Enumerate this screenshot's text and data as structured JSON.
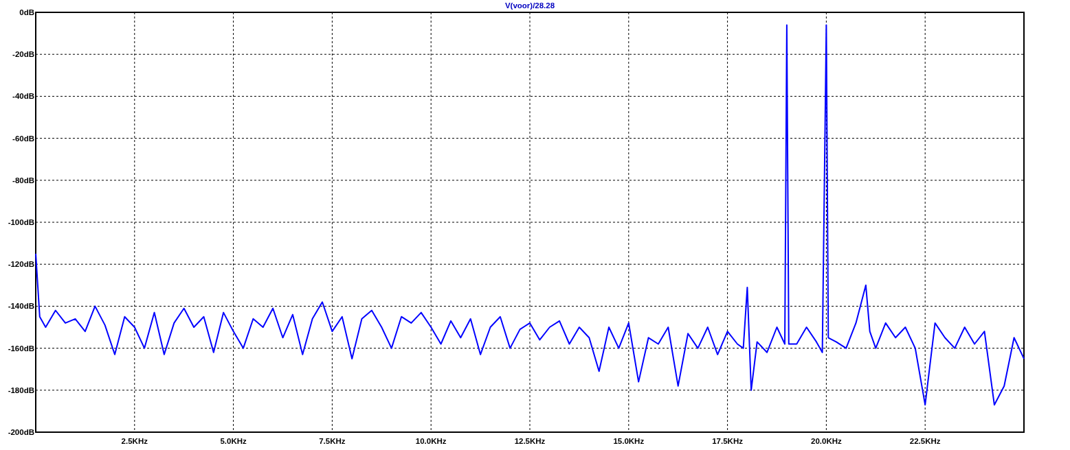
{
  "plot": {
    "chart_data": {
      "type": "line",
      "title": "V(voor)/28.28",
      "x": [
        0,
        0.1,
        0.25,
        0.5,
        0.75,
        1,
        1.25,
        1.5,
        1.75,
        2,
        2.25,
        2.5,
        2.75,
        3,
        3.25,
        3.5,
        3.75,
        4,
        4.25,
        4.5,
        4.75,
        5,
        5.25,
        5.5,
        5.75,
        6,
        6.25,
        6.5,
        6.75,
        7,
        7.25,
        7.5,
        7.75,
        8,
        8.25,
        8.5,
        8.75,
        9,
        9.25,
        9.5,
        9.75,
        10,
        10.25,
        10.5,
        10.75,
        11,
        11.25,
        11.5,
        11.75,
        12,
        12.25,
        12.5,
        12.75,
        13,
        13.25,
        13.5,
        13.75,
        14,
        14.25,
        14.5,
        14.75,
        15,
        15.25,
        15.5,
        15.75,
        16,
        16.25,
        16.5,
        16.75,
        17,
        17.25,
        17.5,
        17.75,
        17.9,
        18,
        18.1,
        18.25,
        18.5,
        18.75,
        18.95,
        19,
        19.05,
        19.25,
        19.5,
        19.75,
        19.9,
        20,
        20.05,
        20.25,
        20.5,
        20.75,
        21,
        21.1,
        21.25,
        21.5,
        21.75,
        22,
        22.25,
        22.5,
        22.75,
        23,
        23.25,
        23.5,
        23.75,
        24,
        24.25,
        24.5,
        24.75,
        25
      ],
      "series": [
        {
          "color": "#0000ff",
          "values": [
            -115,
            -145,
            -150,
            -142,
            -148,
            -146,
            -152,
            -140,
            -149,
            -163,
            -145,
            -150,
            -160,
            -143,
            -163,
            -148,
            -141,
            -150,
            -145,
            -162,
            -143,
            -152,
            -160,
            -146,
            -150,
            -141,
            -155,
            -144,
            -163,
            -146,
            -138,
            -152,
            -145,
            -165,
            -146,
            -142,
            -150,
            -160,
            -145,
            -148,
            -143,
            -150,
            -158,
            -147,
            -155,
            -146,
            -163,
            -150,
            -145,
            -160,
            -151,
            -148,
            -156,
            -150,
            -147,
            -158,
            -150,
            -155,
            -171,
            -150,
            -160,
            -148,
            -176,
            -155,
            -158,
            -150,
            -178,
            -153,
            -160,
            -150,
            -163,
            -152,
            -158,
            -160,
            -131,
            -180,
            -157,
            -162,
            -150,
            -158,
            -6,
            -158,
            -158,
            -150,
            -157,
            -162,
            -6,
            -155,
            -157,
            -160,
            -148,
            -130,
            -152,
            -160,
            -148,
            -155,
            -150,
            -160,
            -187,
            -148,
            -155,
            -160,
            -150,
            -158,
            -152,
            -187,
            -178,
            -155,
            -165
          ]
        }
      ],
      "grid": true,
      "xlim": [
        0,
        25
      ],
      "ylim": [
        -200,
        0
      ],
      "xticks": [
        {
          "value": 2.5,
          "label": "2.5KHz"
        },
        {
          "value": 5,
          "label": "5.0KHz"
        },
        {
          "value": 7.5,
          "label": "7.5KHz"
        },
        {
          "value": 10,
          "label": "10.0KHz"
        },
        {
          "value": 12.5,
          "label": "12.5KHz"
        },
        {
          "value": 15,
          "label": "15.0KHz"
        },
        {
          "value": 17.5,
          "label": "17.5KHz"
        },
        {
          "value": 20,
          "label": "20.0KHz"
        },
        {
          "value": 22.5,
          "label": "22.5KHz"
        }
      ],
      "yticks": [
        {
          "value": 0,
          "label": "0dB"
        },
        {
          "value": -20,
          "label": "-20dB"
        },
        {
          "value": -40,
          "label": "-40dB"
        },
        {
          "value": -60,
          "label": "-60dB"
        },
        {
          "value": -80,
          "label": "-80dB"
        },
        {
          "value": -100,
          "label": "-100dB"
        },
        {
          "value": -120,
          "label": "-120dB"
        },
        {
          "value": -140,
          "label": "-140dB"
        },
        {
          "value": -160,
          "label": "-160dB"
        },
        {
          "value": -180,
          "label": "-180dB"
        },
        {
          "value": -200,
          "label": "-200dB"
        }
      ]
    }
  }
}
